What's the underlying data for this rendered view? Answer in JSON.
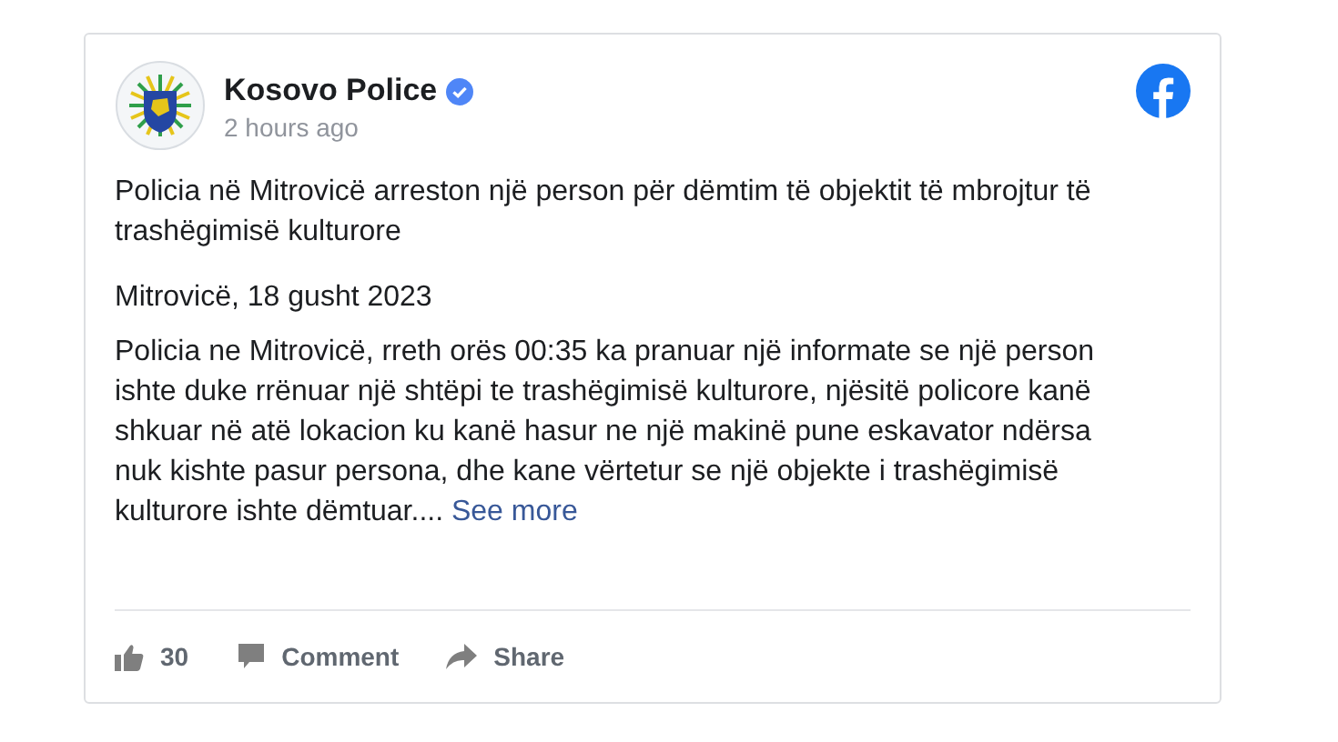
{
  "post": {
    "author": "Kosovo Police",
    "verified": true,
    "time": "2 hours ago",
    "title": "Policia në Mitrovicë arreston një person për dëmtim të objektit të mbrojtur të trashëgimisë kulturore",
    "date": "Mitrovicë, 18 gusht 2023",
    "body": "Policia ne Mitrovicë, rreth orës 00:35 ka pranuar një informate se një person ishte duke rrënuar një shtëpi te trashëgimisë kulturore, njësitë policore kanë shkuar në atë lokacion ku kanë hasur ne një makinë pune eskavator ndërsa nuk kishte pasur persona, dhe kane vërtetur se një objekte i trashëgimisë kulturore ishte dëmtuar....",
    "see_more": "See more",
    "likes": "30",
    "actions": [
      {
        "kind": "comment",
        "label": "Comment"
      },
      {
        "kind": "share",
        "label": "Share"
      }
    ]
  }
}
